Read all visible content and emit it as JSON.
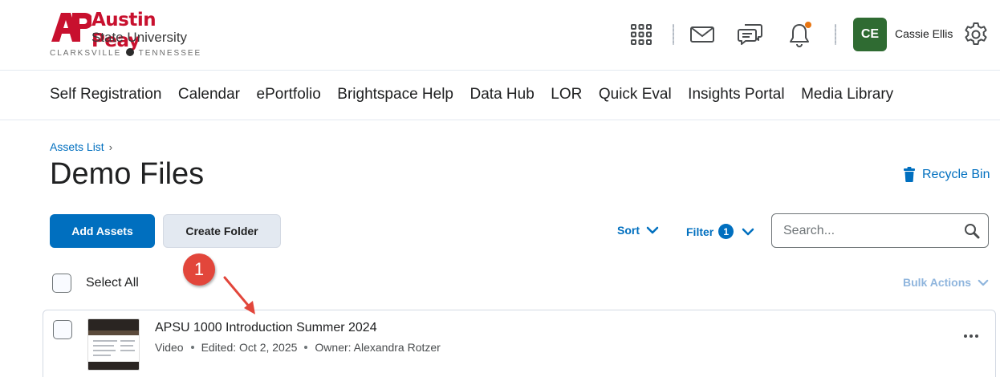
{
  "brand": {
    "logo_mark": "AP",
    "line1": "Austin Peay",
    "line2": "State University",
    "line3_left": "CLARKSVILLE",
    "line3_right": "TENNESSEE"
  },
  "header": {
    "icons": [
      "apps-grid-icon",
      "mail-icon",
      "chat-icon",
      "bell-icon",
      "settings-gear-icon"
    ],
    "notification_dot_color": "#e87511",
    "user": {
      "initials": "CE",
      "name": "Cassie Ellis",
      "avatar_color": "#2f6b32"
    }
  },
  "nav": {
    "items": [
      {
        "label": "Self Registration"
      },
      {
        "label": "Calendar"
      },
      {
        "label": "ePortfolio"
      },
      {
        "label": "Brightspace Help"
      },
      {
        "label": "Data Hub"
      },
      {
        "label": "LOR"
      },
      {
        "label": "Quick Eval"
      },
      {
        "label": "Insights Portal"
      },
      {
        "label": "Media Library"
      }
    ]
  },
  "page": {
    "breadcrumb": "Assets List",
    "title": "Demo Files",
    "recycle_bin": "Recycle Bin"
  },
  "toolbar": {
    "add_assets": "Add Assets",
    "create_folder": "Create Folder",
    "sort": "Sort",
    "filter": "Filter",
    "filter_count": "1",
    "search_placeholder": "Search..."
  },
  "list": {
    "select_all": "Select All",
    "bulk_actions": "Bulk Actions",
    "items": [
      {
        "title": "APSU 1000 Introduction Summer 2024",
        "type": "Video",
        "edited": "Edited: Oct 2, 2025",
        "owner": "Owner: Alexandra Rotzer"
      }
    ]
  },
  "annotation": {
    "number": "1",
    "color": "#e2463b"
  },
  "colors": {
    "accent": "#006fbf",
    "brand_red": "#c8102e"
  }
}
